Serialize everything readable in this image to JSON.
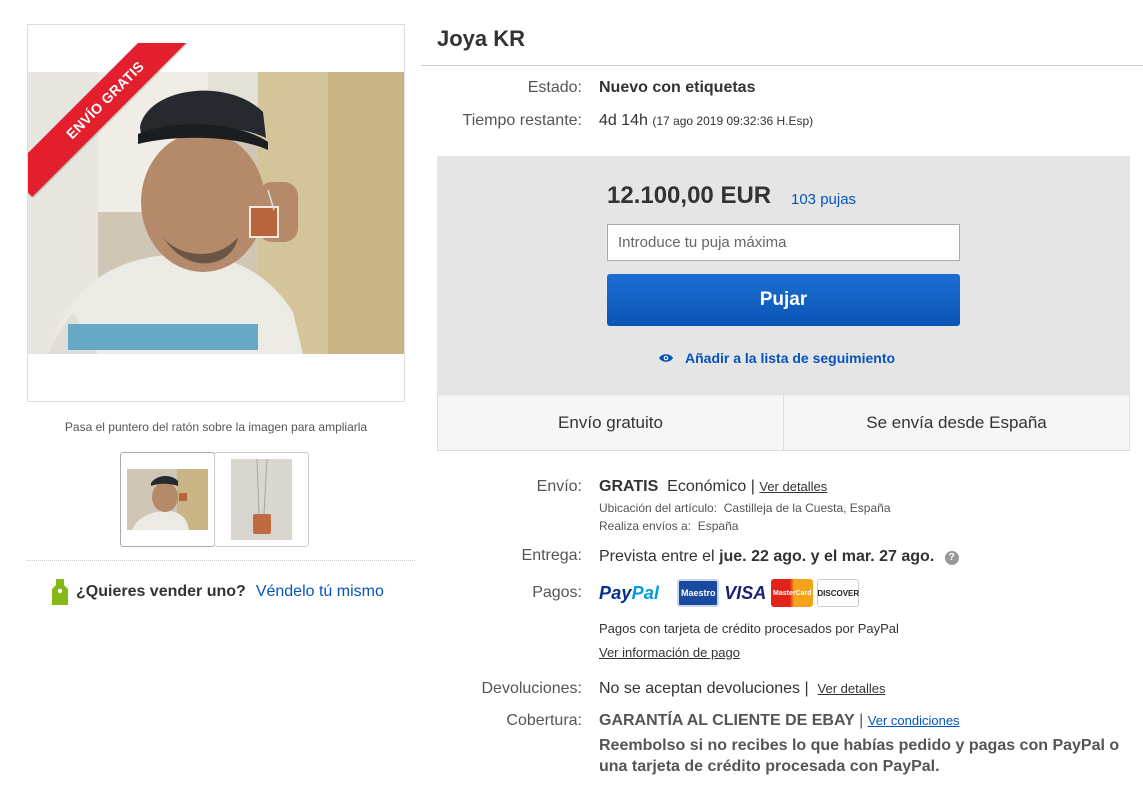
{
  "gallery": {
    "ribbon_text": "ENVÍO GRATIS",
    "zoom_hint": "Pasa el puntero del ratón sobre la imagen para ampliarla",
    "sell": {
      "question": "¿Quieres vender uno?",
      "link": "Véndelo tú mismo"
    }
  },
  "item": {
    "title": "Joya KR",
    "condition_label": "Estado:",
    "condition_value": "Nuevo con etiquetas",
    "time_label": "Tiempo restante:",
    "time_value": "4d 14h",
    "time_detail": "(17 ago 2019   09:32:36 H.Esp)"
  },
  "bid": {
    "price": "12.100,00 EUR",
    "bids_count": "103 pujas",
    "input_placeholder": "Introduce tu puja máxima",
    "button_label": "Pujar",
    "watchlist_label": "Añadir a la lista de seguimiento"
  },
  "shipping_panels": {
    "left": "Envío gratuito",
    "right": "Se envía desde España"
  },
  "details": {
    "shipping_label": "Envío:",
    "shipping_free": "GRATIS",
    "shipping_service": "Económico",
    "shipping_details_link": "Ver detalles",
    "location_label": "Ubicación del artículo:",
    "location_value": "Castilleja de la Cuesta, España",
    "ships_to_label": "Realiza envíos a:",
    "ships_to_value": "España",
    "delivery_label": "Entrega:",
    "delivery_prefix": "Prevista entre el",
    "delivery_dates": "jue. 22 ago. y el mar. 27 ago.",
    "payments_label": "Pagos:",
    "payments_note": "Pagos con tarjeta de crédito procesados por PayPal",
    "payments_link": "Ver información de pago",
    "returns_label": "Devoluciones:",
    "returns_value": "No se aceptan devoluciones",
    "returns_link": "Ver detalles",
    "coverage_label": "Cobertura:",
    "coverage_title": "GARANTÍA AL CLIENTE DE EBAY",
    "coverage_link": "Ver condiciones",
    "coverage_text_1": "Reembolso si no recibes lo que habías pedido y pagas con PayPal o",
    "coverage_text_2": "una tarjeta de crédito procesada con PayPal."
  },
  "payment_logos": {
    "paypal_1": "Pay",
    "paypal_2": "Pal",
    "maestro": "Maestro",
    "visa": "VISA",
    "mastercard": "MasterCard",
    "discover": "DISCOVER"
  },
  "colors": {
    "link_blue": "#0654ba",
    "ribbon_red": "#e31e2d",
    "button_blue": "#0b55b7"
  }
}
